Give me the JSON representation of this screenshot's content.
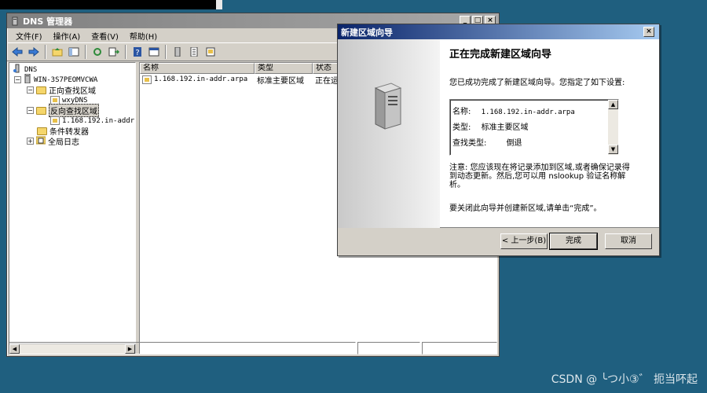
{
  "dns_window": {
    "title": "DNS 管理器",
    "controls": {
      "minimize": "_",
      "maximize": "□",
      "close": "×"
    },
    "menu": [
      "文件(F)",
      "操作(A)",
      "查看(V)",
      "帮助(H)"
    ],
    "tree": {
      "root": "DNS",
      "server": "WIN-3S7PEOMVCWA",
      "forward_zones": "正向查找区域",
      "forward_zone_child": "wxyDNS",
      "reverse_zones": "反向查找区域",
      "reverse_zone_child": "1.168.192.in-addr.",
      "conditional_forwarders": "条件转发器",
      "global_logs": "全局日志"
    },
    "list": {
      "columns": [
        "名称",
        "类型",
        "状态"
      ],
      "rows": [
        {
          "name": "1.168.192.in-addr.arpa",
          "type": "标准主要区域",
          "status": "正在运"
        }
      ]
    }
  },
  "wizard": {
    "title": "新建区域向导",
    "close": "×",
    "heading": "正在完成新建区域向导",
    "intro": "您已成功完成了新建区域向导。您指定了如下设置:",
    "summary": {
      "name_label": "名称:",
      "name_value": "1.168.192.in-addr.arpa",
      "type_label": "类型:",
      "type_value": "标准主要区域",
      "lookup_label": "查找类型:",
      "lookup_value": "倒退"
    },
    "note": "注意: 您应该现在将记录添加到区域,或者确保记录得到动态更新。然后,您可以用 nslookup 验证名称解析。",
    "close_instruction": "要关闭此向导并创建新区域,请单击“完成”。",
    "buttons": {
      "back": "< 上一步(B)",
      "finish": "完成",
      "cancel": "取消"
    }
  },
  "watermark": "CSDN @ ╰つ小③゛ 扼当吥起"
}
